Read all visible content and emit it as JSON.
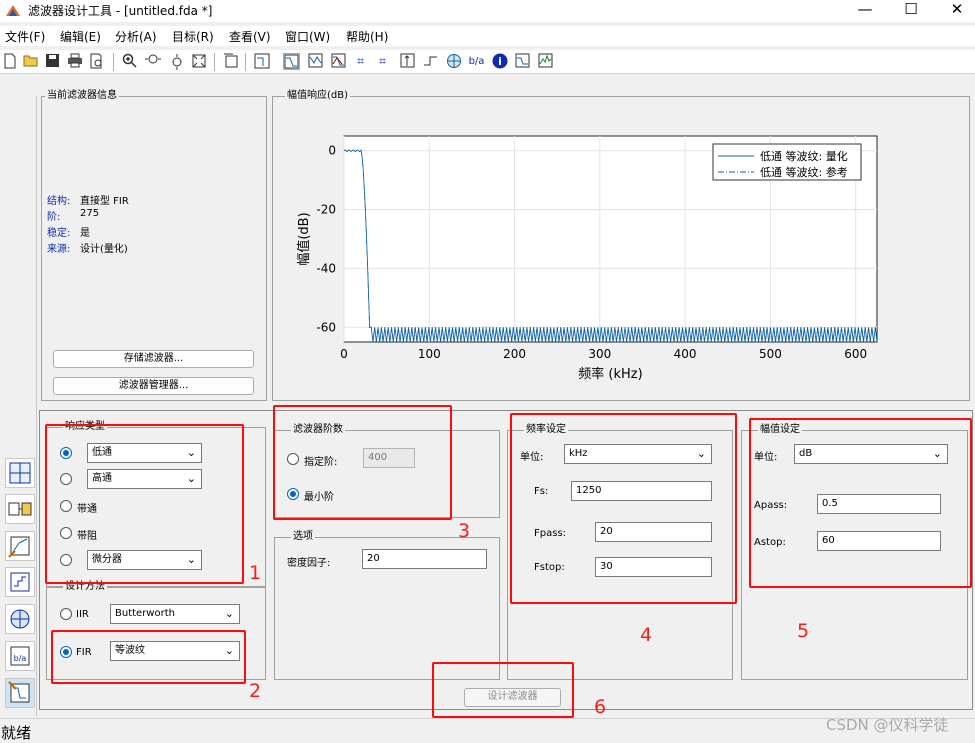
{
  "window": {
    "title": "滤波器设计工具 - [untitled.fda *]",
    "minimize": "—",
    "maximize": "☐",
    "close": "✕"
  },
  "menu": [
    "文件(F)",
    "编辑(E)",
    "分析(A)",
    "目标(R)",
    "查看(V)",
    "窗口(W)",
    "帮助(H)"
  ],
  "toolbar": {
    "icons": [
      "new-file-icon",
      "open-folder-icon",
      "save-icon",
      "print-icon",
      "print-preview-icon",
      "zoom-in-icon",
      "zoom-x-icon",
      "zoom-y-icon",
      "full-view-icon",
      "new-window-icon",
      "filter-spec-icon",
      "magnitude-response-icon",
      "phase-response-icon",
      "mag-phase-icon",
      "group-delay-icon",
      "phase-delay-icon",
      "impulse-response-icon",
      "step-response-icon",
      "pole-zero-icon",
      "coefficients-icon",
      "info-icon",
      "magnitude-estimate-icon",
      "noise-power-icon"
    ]
  },
  "info_panel": {
    "title": "当前滤波器信息",
    "rows": [
      {
        "key": "结构:",
        "value": "直接型 FIR"
      },
      {
        "key": "阶:",
        "value": "275"
      },
      {
        "key": "稳定:",
        "value": "是"
      },
      {
        "key": "来源:",
        "value": "设计(量化)"
      }
    ],
    "store_button": "存储滤波器...",
    "manager_button": "滤波器管理器..."
  },
  "plot_panel": {
    "title": "幅值响应(dB)"
  },
  "chart_data": {
    "type": "line",
    "xlabel": "频率 (kHz)",
    "ylabel": "幅值(dB)",
    "xlim": [
      0,
      625
    ],
    "ylim": [
      -65,
      5
    ],
    "xticks": [
      0,
      100,
      200,
      300,
      400,
      500,
      600
    ],
    "yticks": [
      0,
      -20,
      -40,
      -60
    ],
    "grid": true,
    "legend_position": "top-right",
    "series": [
      {
        "name": "低通 等波纹: 量化",
        "style": "solid",
        "color": "#0c62a8"
      },
      {
        "name": "低通 等波纹: 参考",
        "style": "dash-dot",
        "color": "#0c62a8"
      }
    ],
    "passband_edge_khz": 20,
    "stopband_edge_khz": 30,
    "passband_ripple_db": 0.5,
    "stopband_level_db": -60
  },
  "response_type": {
    "title": "响应类型",
    "options": [
      {
        "label": "低通",
        "kind": "select",
        "selected": true
      },
      {
        "label": "高通",
        "kind": "select",
        "selected": false
      },
      {
        "label": "带通",
        "kind": "plain",
        "selected": false
      },
      {
        "label": "带阻",
        "kind": "plain",
        "selected": false
      },
      {
        "label": "微分器",
        "kind": "select",
        "selected": false
      }
    ]
  },
  "design_method": {
    "title": "设计方法",
    "iir_label": "IIR",
    "iir_value": "Butterworth",
    "fir_label": "FIR",
    "fir_value": "等波纹",
    "fir_selected": true
  },
  "filter_order": {
    "title": "滤波器阶数",
    "specify_label": "指定阶:",
    "specify_value": "400",
    "min_label": "最小阶",
    "min_selected": true
  },
  "options": {
    "title": "选项",
    "density_label": "密度因子:",
    "density_value": "20"
  },
  "freq_spec": {
    "title": "频率设定",
    "unit_label": "单位:",
    "unit_value": "kHz",
    "fs_label": "Fs:",
    "fs_value": "1250",
    "fpass_label": "Fpass:",
    "fpass_value": "20",
    "fstop_label": "Fstop:",
    "fstop_value": "30"
  },
  "mag_spec": {
    "title": "幅值设定",
    "unit_label": "单位:",
    "unit_value": "dB",
    "apass_label": "Apass:",
    "apass_value": "0.5",
    "astop_label": "Astop:",
    "astop_value": "60"
  },
  "design_button": "设计滤波器",
  "annotations": [
    "1",
    "2",
    "3",
    "4",
    "5",
    "6"
  ],
  "sidebar_icons": [
    "transform-icon",
    "realize-model-icon",
    "pole-zero-editor-icon",
    "quantize-icon",
    "import-filter-icon",
    "multirate-icon",
    "design-filter-icon"
  ],
  "status": "就绪",
  "watermark": "CSDN @仪科学徒",
  "colors": {
    "annotation": "#ff0a0a",
    "accent": "#0067c0",
    "trace": "#0c62a8"
  }
}
